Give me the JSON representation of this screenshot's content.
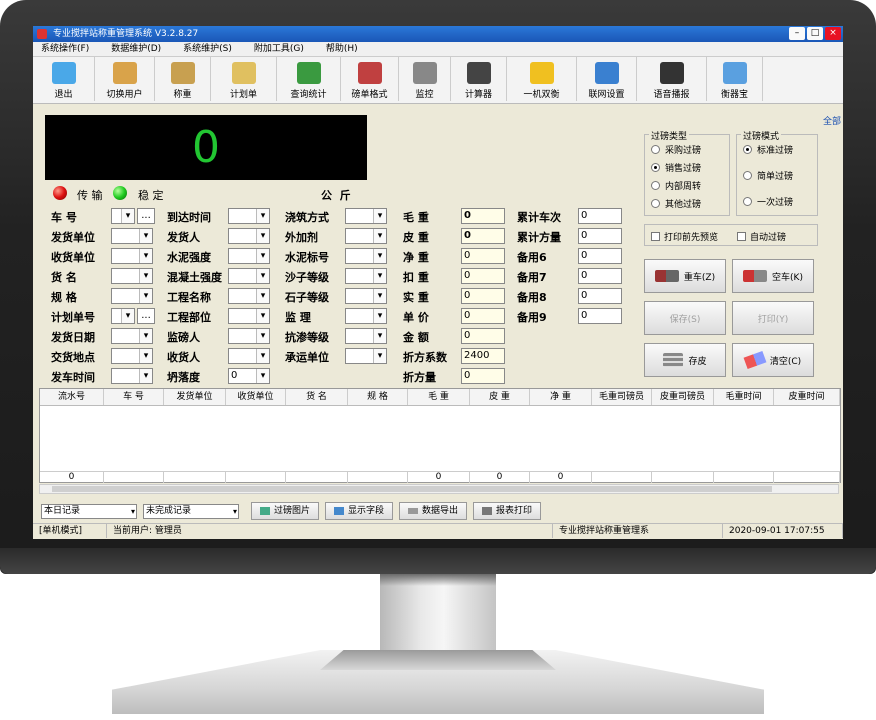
{
  "window": {
    "title": "专业搅拌站称重管理系统 V3.2.8.27"
  },
  "menu": [
    "系统操作(F)",
    "数据维护(D)",
    "系统维护(S)",
    "附加工具(G)",
    "帮助(H)"
  ],
  "toolbar": [
    {
      "label": "退出",
      "icon": "exit-icon"
    },
    {
      "label": "切换用户",
      "icon": "switch-user-icon"
    },
    {
      "label": "称重",
      "icon": "scale-icon"
    },
    {
      "label": "计划单",
      "icon": "plan-icon"
    },
    {
      "label": "查询统计",
      "icon": "stats-icon"
    },
    {
      "label": "磅单格式",
      "icon": "tools-icon"
    },
    {
      "label": "监控",
      "icon": "camera-icon"
    },
    {
      "label": "计算器",
      "icon": "calculator-icon"
    },
    {
      "label": "一机双衡",
      "icon": "truck-icon"
    },
    {
      "label": "联网设置",
      "icon": "network-icon"
    },
    {
      "label": "语音播报",
      "icon": "microphone-icon"
    },
    {
      "label": "衡器宝",
      "icon": "phone-icon"
    }
  ],
  "full_link": "全部",
  "weight": {
    "value": "0",
    "unit": "公  斤",
    "transfer": "传 输",
    "stable": "稳 定"
  },
  "form": {
    "col1": [
      "车 号",
      "发货单位",
      "收货单位",
      "货 名",
      "规 格",
      "计划单号",
      "发货日期",
      "交货地点",
      "发车时间"
    ],
    "col2": [
      "到达时间",
      "发货人",
      "水泥强度",
      "混凝土强度",
      "工程名称",
      "工程部位",
      "监磅人",
      "收货人",
      "坍落度"
    ],
    "col3": [
      "浇筑方式",
      "外加剂",
      "水泥标号",
      "沙子等级",
      "石子等级",
      "监 理",
      "抗渗等级",
      "承运单位"
    ],
    "col4": [
      "毛 重",
      "皮 重",
      "净 重",
      "扣 重",
      "实 重",
      "单 价",
      "金 额",
      "折方系数",
      "折方量"
    ],
    "col4_values": [
      "0",
      "0",
      "0",
      "0",
      "0",
      "0",
      "0",
      "2400",
      "0"
    ],
    "col5": [
      "累计车次",
      "累计方量",
      "备用6",
      "备用7",
      "备用8",
      "备用9"
    ],
    "col5_values": [
      "0",
      "0",
      "0",
      "0",
      "0",
      "0"
    ],
    "slump_value": "0",
    "plate_button": "..."
  },
  "weigh_type": {
    "title": "过磅类型",
    "options": [
      "采购过磅",
      "销售过磅",
      "内部周转",
      "其他过磅"
    ],
    "selected": "销售过磅"
  },
  "weigh_mode": {
    "title": "过磅模式",
    "options": [
      "标准过磅",
      "简单过磅",
      "一次过磅"
    ],
    "selected": "标准过磅"
  },
  "checks": [
    "打印前先预览",
    "自动过磅"
  ],
  "buttons": {
    "heavy": "重车(Z)",
    "empty": "空车(K)",
    "save": "保存(S)",
    "print": "打印(Y)",
    "tare": "存皮",
    "clear": "清空(C)"
  },
  "table": {
    "columns": [
      "流水号",
      "车 号",
      "发货单位",
      "收货单位",
      "货 名",
      "规 格",
      "毛 重",
      "皮 重",
      "净 重",
      "毛重司磅员",
      "皮重司磅员",
      "毛重时间",
      "皮重时间"
    ],
    "totals": [
      "0",
      "",
      "",
      "",
      "",
      "",
      "0",
      "0",
      "0",
      "",
      "",
      "",
      ""
    ]
  },
  "bottom": {
    "record_filter": "本日记录",
    "status_filter": "未完成记录",
    "btn_photo": "过磅图片",
    "btn_fields": "显示字段",
    "btn_export": "数据导出",
    "btn_print": "报表打印"
  },
  "status": {
    "mode": "[单机模式]",
    "user": "当前用户: 管理员",
    "app": "专业搅拌站称重管理系",
    "datetime": "2020-09-01 17:07:55"
  }
}
